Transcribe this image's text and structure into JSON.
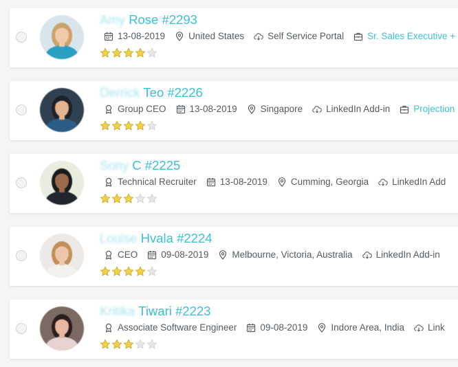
{
  "colors": {
    "accent": "#3bbfd6",
    "name_faded": "#a7e3ee",
    "meta_text": "#555b61",
    "star_filled": "#f0d24a",
    "star_empty": "#e6e6e6"
  },
  "candidates": [
    {
      "first": "Amy",
      "rest": " Rose #2293",
      "meta": [
        {
          "icon": "calendar-icon",
          "text": "13-08-2019"
        },
        {
          "icon": "location-pin-icon",
          "text": "United States"
        },
        {
          "icon": "cloud-download-icon",
          "text": "Self Service Portal"
        },
        {
          "icon": "briefcase-icon",
          "text": "Sr. Sales Executive +",
          "link": true
        }
      ],
      "rating": 4,
      "avatar": {
        "bg": "#d9e4ec",
        "skin": "#f0c9a8",
        "hair": "#c9a36a",
        "cloth": "#2a9fc1"
      }
    },
    {
      "first": "Derrick",
      "rest": " Teo #2226",
      "meta": [
        {
          "icon": "award-icon",
          "text": "Group CEO"
        },
        {
          "icon": "calendar-icon",
          "text": "13-08-2019"
        },
        {
          "icon": "location-pin-icon",
          "text": "Singapore"
        },
        {
          "icon": "cloud-download-icon",
          "text": "LinkedIn Add-in"
        },
        {
          "icon": "briefcase-icon",
          "text": "Projection",
          "link": true
        }
      ],
      "rating": 4,
      "avatar": {
        "bg": "#2f4150",
        "skin": "#e2b48f",
        "hair": "#1e2227",
        "cloth": "#2b5d86"
      }
    },
    {
      "first": "Sony",
      "rest": " C #2225",
      "meta": [
        {
          "icon": "award-icon",
          "text": "Technical Recruiter"
        },
        {
          "icon": "calendar-icon",
          "text": "13-08-2019"
        },
        {
          "icon": "location-pin-icon",
          "text": "Cumming, Georgia"
        },
        {
          "icon": "cloud-download-icon",
          "text": "LinkedIn Add"
        }
      ],
      "rating": 3,
      "avatar": {
        "bg": "#e8ede0",
        "skin": "#9c6b4e",
        "hair": "#1b1b1d",
        "cloth": "#22252c"
      }
    },
    {
      "first": "Louise",
      "rest": " Hvala #2224",
      "meta": [
        {
          "icon": "award-icon",
          "text": "CEO"
        },
        {
          "icon": "calendar-icon",
          "text": "09-08-2019"
        },
        {
          "icon": "location-pin-icon",
          "text": "Melbourne, Victoria, Australia"
        },
        {
          "icon": "cloud-download-icon",
          "text": "LinkedIn Add-in"
        }
      ],
      "rating": 4,
      "avatar": {
        "bg": "#ece9e6",
        "skin": "#eec6ab",
        "hair": "#c28f58",
        "cloth": "#f3f1ee"
      }
    },
    {
      "first": "Kritika",
      "rest": " Tiwari #2223",
      "meta": [
        {
          "icon": "award-icon",
          "text": "Associate Software Engineer"
        },
        {
          "icon": "calendar-icon",
          "text": "09-08-2019"
        },
        {
          "icon": "location-pin-icon",
          "text": "Indore Area, India"
        },
        {
          "icon": "cloud-download-icon",
          "text": "Link"
        }
      ],
      "rating": 3,
      "avatar": {
        "bg": "#7a6a62",
        "skin": "#e6b8a1",
        "hair": "#2a1d1a",
        "cloth": "#e7d3cf"
      }
    }
  ],
  "max_rating": 5
}
